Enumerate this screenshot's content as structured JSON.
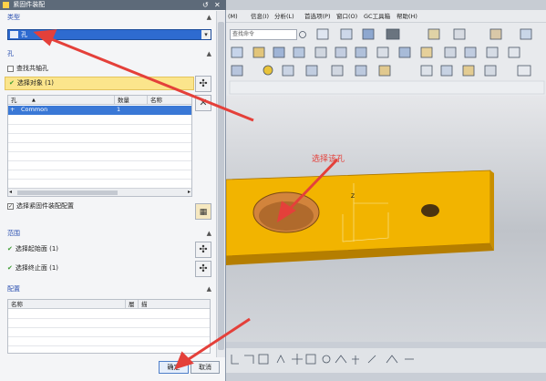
{
  "dialog": {
    "title": "紧固件装配",
    "controls": [
      "↺",
      "✕"
    ],
    "type_section": {
      "header": "类型",
      "selected": "孔"
    },
    "hole_section": {
      "header": "孔",
      "find_coaxial": "查找共轴孔",
      "select_object": "选择对象 (1)",
      "table_headers": [
        "孔",
        "数量",
        "名称"
      ],
      "rows": [
        {
          "expand": "+",
          "name": "Common",
          "count": "1",
          "label": ""
        }
      ],
      "select_fastener_assembly": "选择紧固件装配配置"
    },
    "range_section": {
      "header": "范围",
      "select_start": "选择起始面 (1)",
      "select_end": "选择终止面 (1)"
    },
    "config_section": {
      "header": "配置",
      "table_headers": [
        "名称",
        "層",
        "描"
      ]
    },
    "ok_label": "确定",
    "cancel_label": "取消"
  },
  "menubar": {
    "items": [
      "(M)",
      "信息(I)",
      "分析(L)",
      "首选项(P)",
      "窗口(O)",
      "GC工具箱",
      "帮助(H)"
    ]
  },
  "toolbar": {
    "search_placeholder": "查找命令"
  },
  "annotation": {
    "text": "选择该孔"
  },
  "colors": {
    "part": "#f2b400",
    "arrow": "#e4403a",
    "title_bar": "#5d6a79",
    "selected_row": "#3a78d6"
  }
}
